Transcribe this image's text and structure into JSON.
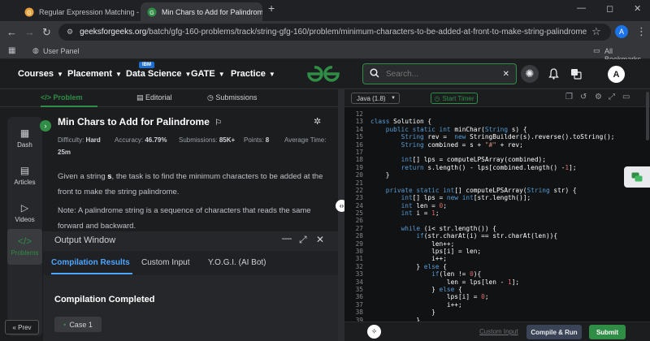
{
  "browser": {
    "tabs": [
      {
        "label": "Regular Expression Matching - G",
        "active": false
      },
      {
        "label": "Min Chars to Add for Palindrom",
        "active": true
      }
    ],
    "new_tab": "+",
    "window_controls": {
      "minimize": "—",
      "maximize": "◻",
      "close": "✕"
    },
    "url_domain": "geeksforgeeks.org",
    "url_path": "/batch/gfg-160-problems/track/string-gfg-160/problem/minimum-characters-to-be-added-at-front-to-make-string-palindrome",
    "profile_initial": "A",
    "bookmarks": {
      "user_panel": "User Panel",
      "all_bookmarks": "All Bookmarks"
    }
  },
  "header": {
    "nav": [
      {
        "label": "Courses"
      },
      {
        "label": "Placement"
      },
      {
        "label": "Data Science"
      },
      {
        "label": "GATE"
      },
      {
        "label": "Practice"
      }
    ],
    "ibm_badge": "IBM",
    "logo": "GG",
    "search_placeholder": "Search...",
    "avatar_initial": "A"
  },
  "problem_tabs": [
    {
      "label": "Problem",
      "icon": "</>"
    },
    {
      "label": "Editorial",
      "icon": "▤"
    },
    {
      "label": "Submissions",
      "icon": "◷"
    }
  ],
  "sidebar": {
    "items": [
      {
        "label": "Dash",
        "icon": "▦"
      },
      {
        "label": "Articles",
        "icon": "▤"
      },
      {
        "label": "Videos",
        "icon": "▷"
      },
      {
        "label": "Problems",
        "icon": "</>"
      }
    ],
    "prev_label": "Prev"
  },
  "problem": {
    "title": "Min Chars to Add for Palindrome",
    "difficulty_label": "Difficulty:",
    "difficulty": "Hard",
    "accuracy_label": "Accuracy:",
    "accuracy": "46.79%",
    "submissions_label": "Submissions:",
    "submissions": "85K+",
    "points_label": "Points:",
    "points": "8",
    "avg_time_label": "Average Time:",
    "avg_time": "25m",
    "desc1_a": "Given a string ",
    "desc1_var": "s",
    "desc1_b": ", the task is to find the minimum characters to be added at the",
    "desc1_c": "front to make the string palindrome.",
    "note1": "Note: A palindrome string is a sequence of characters that reads the same",
    "note2": "forward and backward."
  },
  "output": {
    "title": "Output Window",
    "tabs": [
      {
        "label": "Compilation Results",
        "active": true
      },
      {
        "label": "Custom Input",
        "active": false
      },
      {
        "label": "Y.O.G.I. (AI Bot)",
        "active": false
      }
    ],
    "status": "Compilation Completed",
    "case_label": "Case 1"
  },
  "editor": {
    "language": "Java (1.8)",
    "timer_label": "Start Timer",
    "first_line": 12,
    "lines": [
      "",
      "class Solution {",
      "    public static int minChar(String s) {",
      "        String rev =  new StringBuilder(s).reverse().toString();",
      "        String combined = s + \"#\" + rev;",
      "",
      "        int[] lps = computeLPSArray(combined);",
      "        return s.length() - lps[combined.length() -1];",
      "    }",
      "",
      "    private static int[] computeLPSArray(String str) {",
      "        int[] lps = new int[str.length()];",
      "        int len = 0;",
      "        int i = 1;",
      "",
      "        while (i< str.length()) {",
      "            if(str.charAt(i) == str.charAt(len)){",
      "                len++;",
      "                lps[i] = len;",
      "                i++;",
      "            } else {",
      "                if(len != 0){",
      "                    len = lps[len - 1];",
      "                } else {",
      "                    lps[i] = 0;",
      "                    i++;",
      "                }",
      "            }"
    ],
    "custom_input": "Custom Input",
    "compile_run": "Compile & Run",
    "submit": "Submit"
  },
  "colors": {
    "accent_green": "#2f8d46",
    "tab_blue": "#4da6ff",
    "keyword": "#569cd6",
    "string": "#ce9178",
    "number": "#e06c6c"
  }
}
